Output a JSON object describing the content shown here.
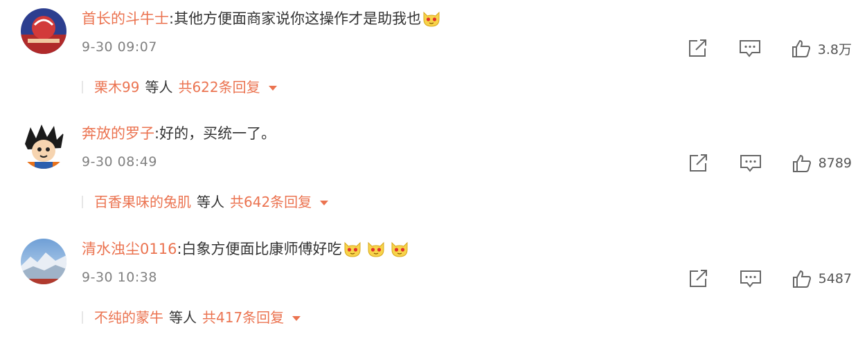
{
  "comments": [
    {
      "username": "首长的斗牛士",
      "separator": ":",
      "text": "其他方便面商家说你这操作才是助我也",
      "emoji_count": 1,
      "time": "9-30 09:07",
      "likes": "3.8万",
      "reply_user": "栗木99",
      "reply_etc": "等人",
      "reply_total": "共622条回复"
    },
    {
      "username": "奔放的罗子",
      "separator": ":",
      "text": "好的，买统一了。",
      "emoji_count": 0,
      "time": "9-30 08:49",
      "likes": "8789",
      "reply_user": "百香果味的兔肌",
      "reply_etc": "等人",
      "reply_total": "共642条回复"
    },
    {
      "username": "清水浊尘0116",
      "separator": ":",
      "text": "白象方便面比康师傅好吃",
      "emoji_count": 3,
      "time": "9-30 10:38",
      "likes": "5487",
      "reply_user": "不纯的蒙牛",
      "reply_etc": "等人",
      "reply_total": "共417条回复"
    }
  ],
  "icons": {
    "share": "share-icon",
    "comment": "comment-icon",
    "like": "thumbs-up-icon",
    "emoji": "cat-face-emoji-icon",
    "expand": "caret-down-icon"
  },
  "colors": {
    "accent": "#eb7350",
    "text": "#333333",
    "muted": "#808080"
  }
}
